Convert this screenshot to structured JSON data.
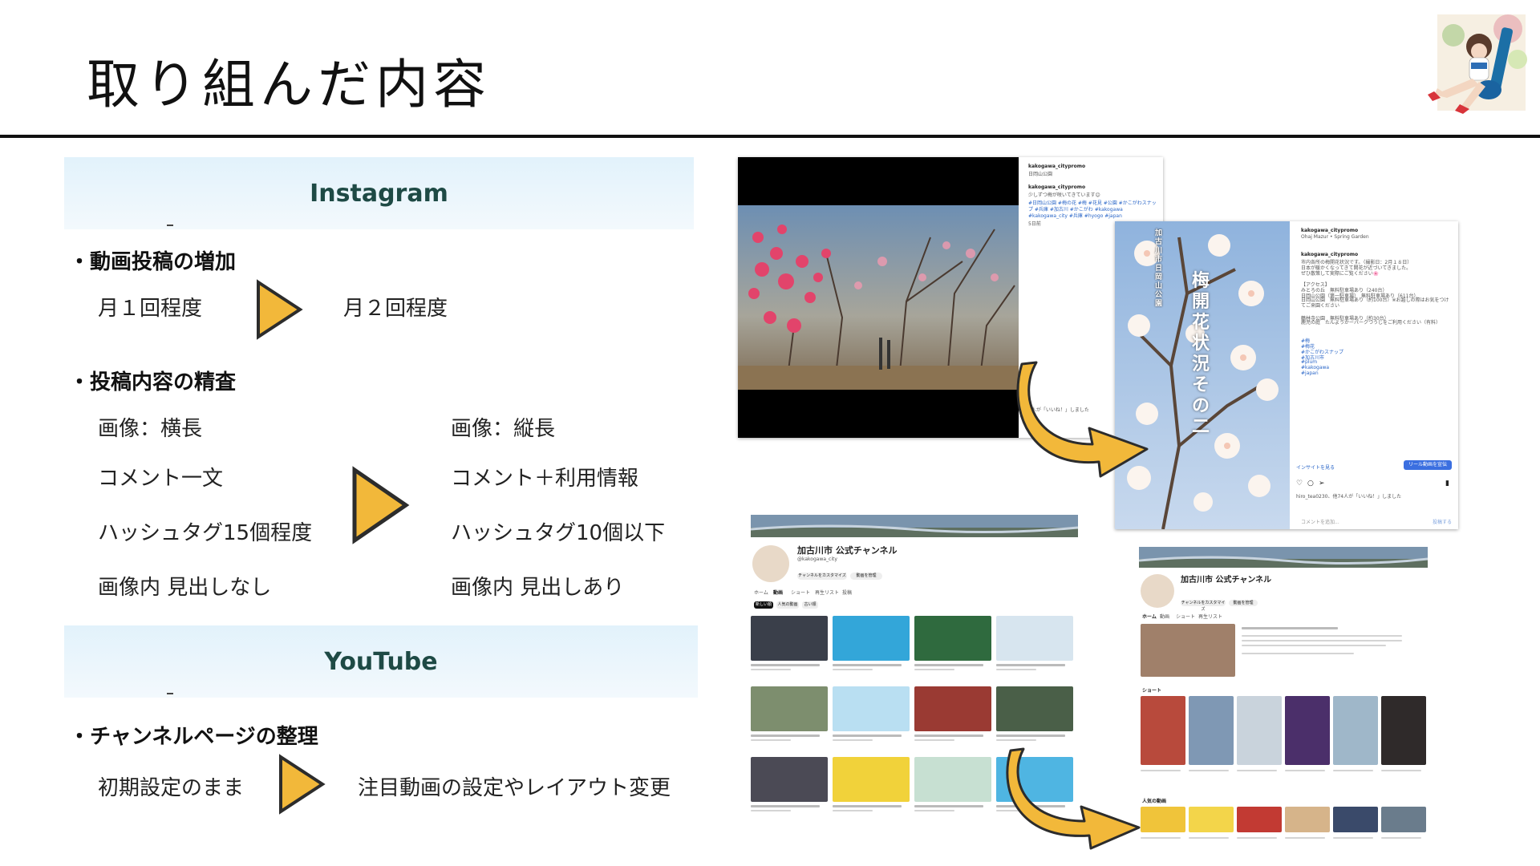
{
  "slide": {
    "title": "取り組んだ内容"
  },
  "instagram": {
    "header": "Instagram",
    "section1": {
      "heading": "・動画投稿の増加",
      "before": "月１回程度",
      "after": "月２回程度"
    },
    "section2": {
      "heading": "・投稿内容の精査",
      "before": [
        "画像：横長",
        "コメント一文",
        "ハッシュタグ15個程度",
        "画像内 見出しなし"
      ],
      "after": [
        "画像：縦長",
        "コメント＋利用情報",
        "ハッシュタグ10個以下",
        "画像内 見出しあり"
      ]
    }
  },
  "youtube": {
    "header": "YouTube",
    "section1": {
      "heading": "・チャンネルページの整理",
      "before": "初期設定のまま",
      "after": "注目動画の設定やレイアウト変更"
    }
  },
  "screens": {
    "ig_old": {
      "account": "kakogawa_citypromo",
      "location": "日岡山公園",
      "comment": "少しずつ梅が咲いてきています😊",
      "tags": "#日岡山公園 #梅の花 #梅 #花見 #公園 #かこがわスナップ #兵庫 #加古川 #かこがわ #kakogawa #kakogawa_city #兵庫 #hyogo #japan",
      "likes": "5日前",
      "liked_by": "2人が「いいね！」しました"
    },
    "ig_new": {
      "account": "kakogawa_citypromo",
      "location": "Ohaj Mazur • Spring Garden",
      "overlay_top": "加古川市 日岡山公園",
      "overlay_main": "梅 開花状況 その二",
      "lines": [
        "市内各所の梅開花状況です。（撮影日：2月１８日）",
        "日本が暖かくなってきて開花が近づいてきました。",
        "ぜひ散策して実際にご覧ください🌸",
        "【アクセス】",
        "みとろの丘　無料駐車場あり（240台）",
        "日岡山公園（第一駐車場）　無料駐車場あり（611台）",
        "日岡山公園　無料駐車場あり（約100台）※お越しの際はお気をつけてご来園ください",
        "鶴林寺公園　無料駐車場あり（約30台）",
        "鹿児の庭　たんようかーパークつうじをご利用ください（有料）"
      ],
      "tags": [
        "#梅",
        "#梅花",
        "#かこがわスナップ",
        "#加古川市",
        "#plum",
        "#kakogawa",
        "#japan"
      ],
      "insight": "インサイトを見る",
      "boost": "リール動画を宣伝",
      "liked_by": "hiro_tea0230、他74人が「いいね！」しました",
      "comment_placeholder": "コメントを追加...",
      "post": "投稿する"
    },
    "yt_old": {
      "channel": "加古川市 公式チャンネル",
      "handle": "@kakogawa_city",
      "tabs": [
        "ホーム",
        "動画",
        "ショート",
        "再生リスト",
        "投稿"
      ],
      "chips": [
        "新しい順",
        "人気の動画",
        "古い順"
      ],
      "btn1": "チャンネルをカスタマイズ",
      "btn2": "動画を管理"
    },
    "yt_new": {
      "channel": "加古川市 公式チャンネル",
      "tabs": [
        "ホーム",
        "動画",
        "ショート",
        "再生リスト"
      ],
      "shorts_label": "ショート",
      "popular_label": "人気の動画",
      "btn1": "チャンネルをカスタマイズ",
      "btn2": "動画を管理"
    }
  },
  "colors": {
    "band": "#e2f2fb",
    "arrow_fill": "#f2b83a",
    "arrow_stroke": "#2c2c2c",
    "band_text": "#1e4a45"
  }
}
